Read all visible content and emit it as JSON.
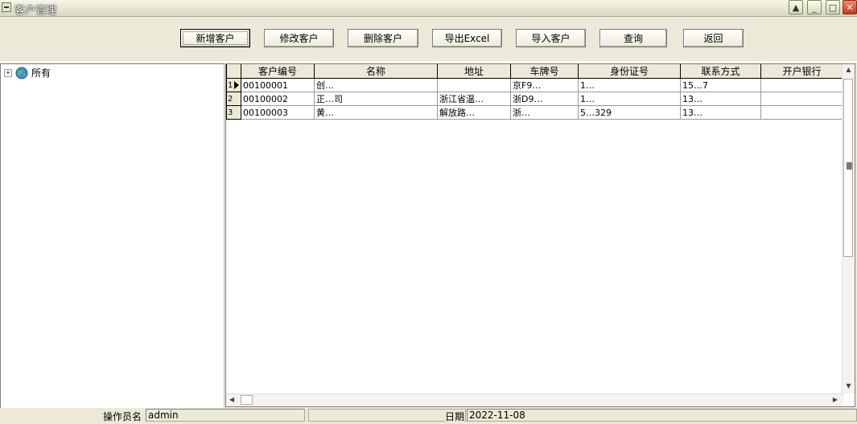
{
  "window": {
    "title": "客户管理",
    "minimize_glyph": "_",
    "maximize_glyph": "□",
    "close_glyph": "✕",
    "restore_glyph": "▲"
  },
  "toolbar": {
    "add_label": "新增客户",
    "edit_label": "修改客户",
    "delete_label": "删除客户",
    "export_label": "导出Excel",
    "import_label": "导入客户",
    "query_label": "查询",
    "back_label": "返回"
  },
  "tree": {
    "expander": "+",
    "root_label": "所有"
  },
  "grid": {
    "columns": [
      "客户编号",
      "名称",
      "地址",
      "车牌号",
      "身份证号",
      "联系方式",
      "开户银行"
    ],
    "rows": [
      {
        "num": "1",
        "id": "00100001",
        "name": "创…",
        "address": "",
        "plate": "京F9…",
        "idcard": "1…",
        "phone": "15…7",
        "bank": ""
      },
      {
        "num": "2",
        "id": "00100002",
        "name": "正…司",
        "address": "浙江省温…",
        "plate": "浙D9…",
        "idcard": "1…",
        "phone": "13…",
        "bank": ""
      },
      {
        "num": "3",
        "id": "00100003",
        "name": "黄…",
        "address": "解放路…",
        "plate": "浙…",
        "idcard": "5…329",
        "phone": "13…",
        "bank": ""
      }
    ]
  },
  "status": {
    "operator_label": "操作员名",
    "operator_value": "admin",
    "date_label": "日期",
    "date_value": "2022-11-08"
  }
}
